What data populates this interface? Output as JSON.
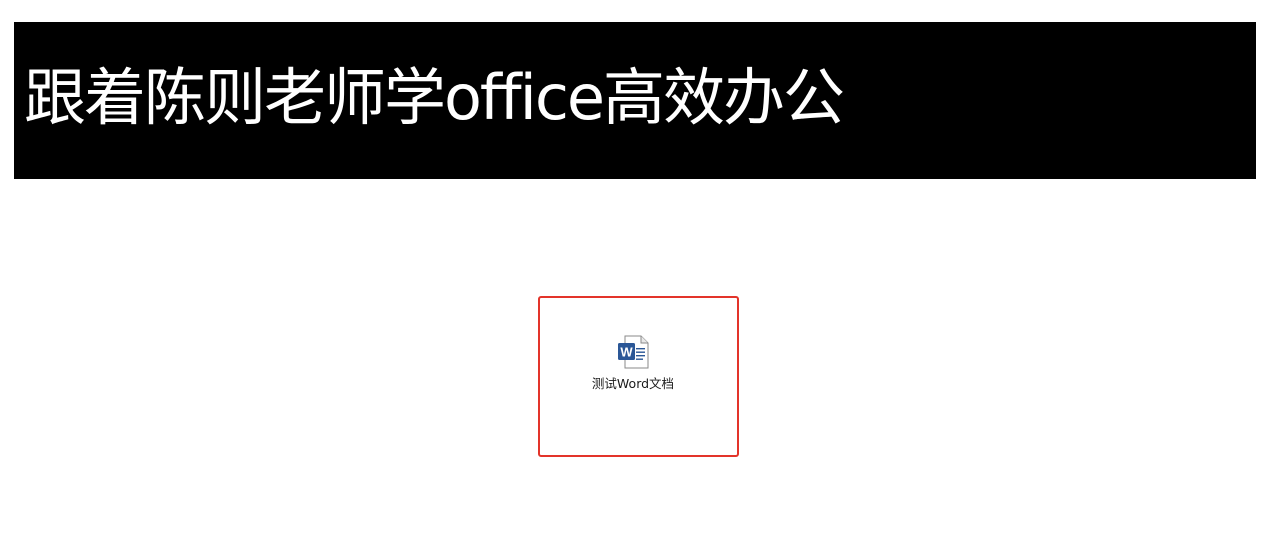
{
  "banner": {
    "title": "跟着陈则老师学office高效办公",
    "background": "#000000",
    "text_color": "#ffffff"
  },
  "desktop": {
    "highlight_color": "#e3342a",
    "file": {
      "icon": "word-document-icon",
      "icon_letter": "W",
      "icon_color": "#2b5797",
      "name": "测试Word文档"
    }
  }
}
